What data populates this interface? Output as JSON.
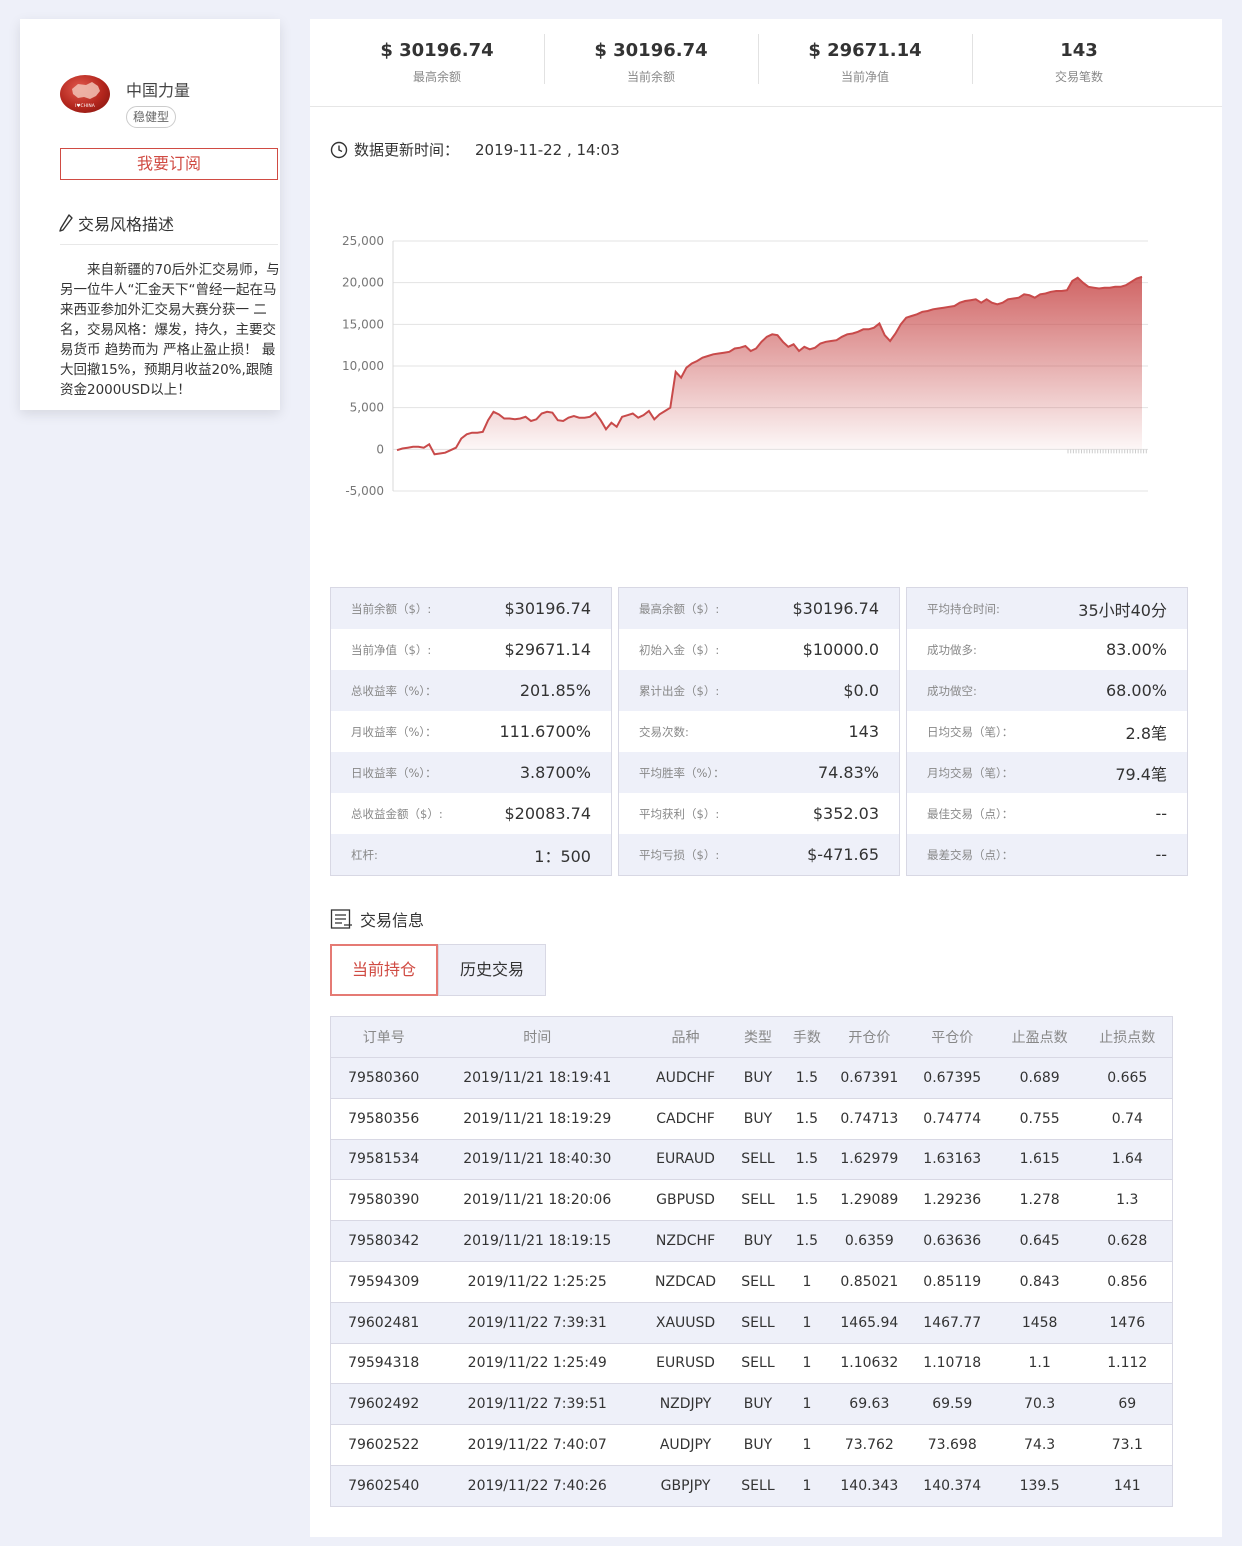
{
  "profile": {
    "name": "中国力量",
    "tag": "稳健型",
    "subscribe_label": "我要订阅",
    "style_title": "交易风格描述",
    "style_desc": "来自新疆的70后外汇交易师，与另一位牛人“汇金天下“曾经一起在马来西亚参加外汇交易大赛分获一 二名，交易风格：爆发，持久，主要交易货币 趋势而为  严格止盈止损！  最大回撤15%，预期月收益20%,跟随资金2000USD以上！",
    "avatar_text": "I♥CHINA"
  },
  "stats": [
    {
      "value": "$ 30196.74",
      "label": "最高余额"
    },
    {
      "value": "$ 30196.74",
      "label": "当前余额"
    },
    {
      "value": "$ 29671.14",
      "label": "当前净值"
    },
    {
      "value": "143",
      "label": "交易笔数"
    }
  ],
  "update": {
    "label": "数据更新时间：",
    "time": "2019-11-22 , 14:03"
  },
  "chart_data": {
    "type": "area",
    "title": "",
    "xlabel": "",
    "ylabel": "",
    "ylim": [
      -5000,
      25000
    ],
    "yticks": [
      25000,
      20000,
      15000,
      10000,
      5000,
      0,
      -5000
    ],
    "ytick_labels": [
      "25,000",
      "20,000",
      "15,000",
      "10,000",
      "5,000",
      "0",
      "-5,000"
    ],
    "grid": true,
    "color": "#c84a4a",
    "values": [
      -100,
      100,
      200,
      300,
      300,
      200,
      600,
      -600,
      -500,
      -400,
      -100,
      200,
      1300,
      1800,
      2000,
      2000,
      2100,
      3500,
      4500,
      4200,
      3700,
      3700,
      3600,
      3700,
      3900,
      3400,
      3600,
      4300,
      4500,
      4400,
      3500,
      3400,
      3800,
      4000,
      3800,
      3800,
      3900,
      4400,
      3500,
      2400,
      3200,
      2700,
      3900,
      4100,
      4300,
      3800,
      4100,
      4600,
      3600,
      4200,
      4600,
      5000,
      9300,
      8600,
      9800,
      10300,
      10600,
      11000,
      11200,
      11400,
      11500,
      11600,
      11700,
      12100,
      12200,
      12400,
      11800,
      12100,
      12900,
      13500,
      13800,
      13700,
      12900,
      12300,
      12600,
      11800,
      12300,
      12000,
      12200,
      12700,
      12900,
      13000,
      13100,
      13500,
      13800,
      13900,
      14100,
      14400,
      14400,
      14600,
      15100,
      13700,
      13000,
      13900,
      15000,
      15800,
      16000,
      16200,
      16500,
      16600,
      16800,
      16900,
      17000,
      17100,
      17200,
      17600,
      17800,
      17900,
      18000,
      17600,
      18000,
      17600,
      17400,
      17600,
      18000,
      18100,
      18200,
      18600,
      18500,
      18200,
      18600,
      18700,
      18900,
      19000,
      19000,
      19100,
      20200,
      20600,
      20000,
      19500,
      19400,
      19300,
      19400,
      19400,
      19500,
      19500,
      19700,
      20100,
      20500,
      20700
    ]
  },
  "metrics": [
    [
      {
        "label": "当前余额（$）:",
        "value": "$30196.74"
      },
      {
        "label": "当前净值（$）:",
        "value": "$29671.14"
      },
      {
        "label": "总收益率（%）：",
        "value": "201.85%"
      },
      {
        "label": "月收益率（%）：",
        "value": "111.6700%"
      },
      {
        "label": "日收益率（%）：",
        "value": "3.8700%"
      },
      {
        "label": "总收益金额（$）:",
        "value": "$20083.74"
      },
      {
        "label": "杠杆:",
        "value": "1：500"
      }
    ],
    [
      {
        "label": "最高余额（$）:",
        "value": "$30196.74"
      },
      {
        "label": "初始入金（$）:",
        "value": "$10000.0"
      },
      {
        "label": "累计出金（$）:",
        "value": "$0.0"
      },
      {
        "label": "交易次数:",
        "value": "143"
      },
      {
        "label": "平均胜率（%）：",
        "value": "74.83%"
      },
      {
        "label": "平均获利（$）:",
        "value": "$352.03"
      },
      {
        "label": "平均亏损（$）:",
        "value": "$-471.65"
      }
    ],
    [
      {
        "label": "平均持仓时间:",
        "value": "35小时40分"
      },
      {
        "label": "成功做多:",
        "value": "83.00%"
      },
      {
        "label": "成功做空:",
        "value": "68.00%"
      },
      {
        "label": "日均交易（笔）：",
        "value": "2.8笔"
      },
      {
        "label": "月均交易（笔）：",
        "value": "79.4笔"
      },
      {
        "label": "最佳交易（点）：",
        "value": "--"
      },
      {
        "label": "最差交易（点）：",
        "value": "--"
      }
    ]
  ],
  "trade": {
    "title": "交易信息",
    "tabs": [
      {
        "label": "当前持仓",
        "active": true
      },
      {
        "label": "历史交易",
        "active": false
      }
    ],
    "columns": [
      "订单号",
      "时间",
      "品种",
      "类型",
      "手数",
      "开仓价",
      "平仓价",
      "止盈点数",
      "止损点数"
    ],
    "rows": [
      [
        "79580360",
        "2019/11/21 18:19:41",
        "AUDCHF",
        "BUY",
        "1.5",
        "0.67391",
        "0.67395",
        "0.689",
        "0.665"
      ],
      [
        "79580356",
        "2019/11/21 18:19:29",
        "CADCHF",
        "BUY",
        "1.5",
        "0.74713",
        "0.74774",
        "0.755",
        "0.74"
      ],
      [
        "79581534",
        "2019/11/21 18:40:30",
        "EURAUD",
        "SELL",
        "1.5",
        "1.62979",
        "1.63163",
        "1.615",
        "1.64"
      ],
      [
        "79580390",
        "2019/11/21 18:20:06",
        "GBPUSD",
        "SELL",
        "1.5",
        "1.29089",
        "1.29236",
        "1.278",
        "1.3"
      ],
      [
        "79580342",
        "2019/11/21 18:19:15",
        "NZDCHF",
        "BUY",
        "1.5",
        "0.6359",
        "0.63636",
        "0.645",
        "0.628"
      ],
      [
        "79594309",
        "2019/11/22 1:25:25",
        "NZDCAD",
        "SELL",
        "1",
        "0.85021",
        "0.85119",
        "0.843",
        "0.856"
      ],
      [
        "79602481",
        "2019/11/22 7:39:31",
        "XAUUSD",
        "SELL",
        "1",
        "1465.94",
        "1467.77",
        "1458",
        "1476"
      ],
      [
        "79594318",
        "2019/11/22 1:25:49",
        "EURUSD",
        "SELL",
        "1",
        "1.10632",
        "1.10718",
        "1.1",
        "1.112"
      ],
      [
        "79602492",
        "2019/11/22 7:39:51",
        "NZDJPY",
        "BUY",
        "1",
        "69.63",
        "69.59",
        "70.3",
        "69"
      ],
      [
        "79602522",
        "2019/11/22 7:40:07",
        "AUDJPY",
        "BUY",
        "1",
        "73.762",
        "73.698",
        "74.3",
        "73.1"
      ],
      [
        "79602540",
        "2019/11/22 7:40:26",
        "GBPJPY",
        "SELL",
        "1",
        "140.343",
        "140.374",
        "139.5",
        "141"
      ]
    ]
  }
}
